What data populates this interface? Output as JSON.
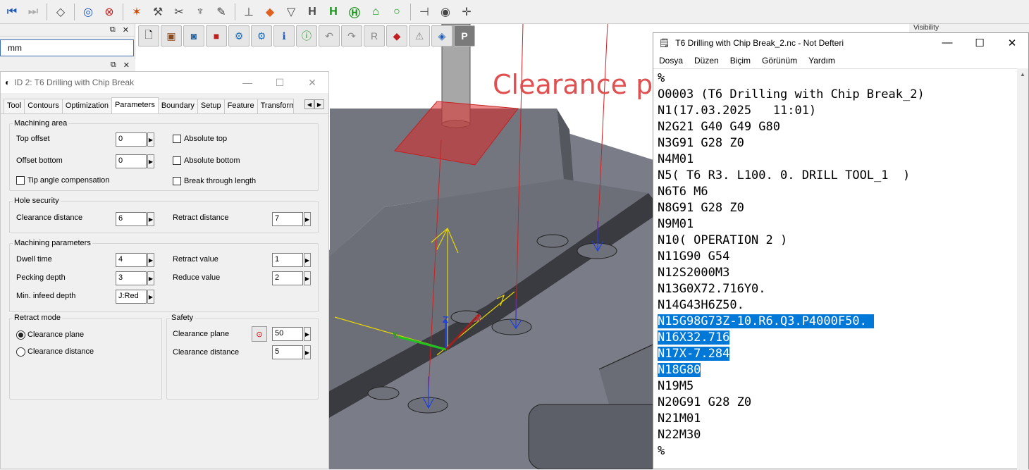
{
  "toolbar": {
    "icons": [
      "rewind-icon",
      "forward-icon",
      "diamond-icon",
      "target-icon",
      "no-target-icon",
      "star-tool-icon",
      "wrench-icon",
      "wrench-alt-icon",
      "trophy-icon",
      "pen-icon",
      "axis-icon",
      "arrow-down-icon",
      "funnel-icon",
      "h-icon",
      "h-green-icon",
      "h-circle-icon",
      "h-house-icon",
      "circle-icon",
      "pin-icon",
      "dial-icon",
      "cross-icon"
    ]
  },
  "units_panel": {
    "value": "mm"
  },
  "visibility_label": "Visibility",
  "viewport": {
    "clearance_label": "Clearance pl",
    "axis": {
      "x": "X",
      "y": "Y",
      "z": "Z"
    }
  },
  "dialog": {
    "title": "ID 2: T6 Drilling with Chip Break",
    "tabs": [
      "Tool",
      "Contours",
      "Optimization",
      "Parameters",
      "Boundary",
      "Setup",
      "Feature",
      "Transform..."
    ],
    "active_tab": "Parameters",
    "machining_area": {
      "legend": "Machining area",
      "top_offset_label": "Top offset",
      "top_offset": "0",
      "offset_bottom_label": "Offset bottom",
      "offset_bottom": "0",
      "tip_angle_label": "Tip angle compensation",
      "absolute_top_label": "Absolute top",
      "absolute_bottom_label": "Absolute bottom",
      "break_through_label": "Break through length"
    },
    "hole_security": {
      "legend": "Hole security",
      "clearance_distance_label": "Clearance distance",
      "clearance_distance": "6",
      "retract_distance_label": "Retract distance",
      "retract_distance": "7"
    },
    "machining_parameters": {
      "legend": "Machining parameters",
      "dwell_time_label": "Dwell time",
      "dwell_time": "4",
      "pecking_depth_label": "Pecking depth",
      "pecking_depth": "3",
      "min_infeed_label": "Min. infeed depth",
      "min_infeed": "J:Red",
      "retract_value_label": "Retract value",
      "retract_value": "1",
      "reduce_value_label": "Reduce value",
      "reduce_value": "2"
    },
    "retract_mode": {
      "legend": "Retract mode",
      "option_plane": "Clearance plane",
      "option_distance": "Clearance distance"
    },
    "safety": {
      "legend": "Safety",
      "clearance_plane_label": "Clearance plane",
      "clearance_plane": "50",
      "clearance_distance_label": "Clearance distance",
      "clearance_distance": "5"
    }
  },
  "notepad": {
    "title": "T6 Drilling with Chip Break_2.nc - Not Defteri",
    "menu": [
      "Dosya",
      "Düzen",
      "Biçim",
      "Görünüm",
      "Yardım"
    ],
    "lines": [
      "%",
      "O0003 (T6 Drilling with Chip Break_2)",
      "N1(17.03.2025   11:01)",
      "N2G21 G40 G49 G80",
      "N3G91 G28 Z0",
      "N4M01",
      "N5( T6 R3. L100. 0. DRILL TOOL_1  )",
      "N6T6 M6",
      "N8G91 G28 Z0",
      "N9M01",
      "N10( OPERATION 2 )",
      "N11G90 G54",
      "N12S2000M3",
      "N13G0X72.716Y0.",
      "N14G43H6Z50.",
      "N15G98G73Z-10.R6.Q3.P4000F50. ",
      "N16X32.716",
      "N17X-7.284",
      "N18G80",
      "N19M5",
      "N20G91 G28 Z0",
      "N21M01",
      "N22M30",
      "%"
    ],
    "selected_lines": [
      15,
      16,
      17,
      18
    ]
  }
}
